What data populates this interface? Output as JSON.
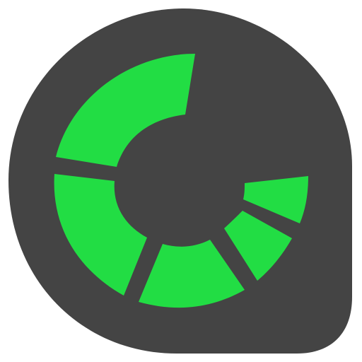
{
  "app_icon": {
    "name": "app-icon",
    "colors": {
      "background": "#ffffff",
      "badge": "#444444",
      "segment": "#22dd44",
      "hole": "#444444"
    },
    "segments": [
      {
        "name": "segment-top-left"
      },
      {
        "name": "segment-left"
      },
      {
        "name": "segment-bottom"
      },
      {
        "name": "segment-bottom-right"
      },
      {
        "name": "segment-right"
      }
    ]
  }
}
